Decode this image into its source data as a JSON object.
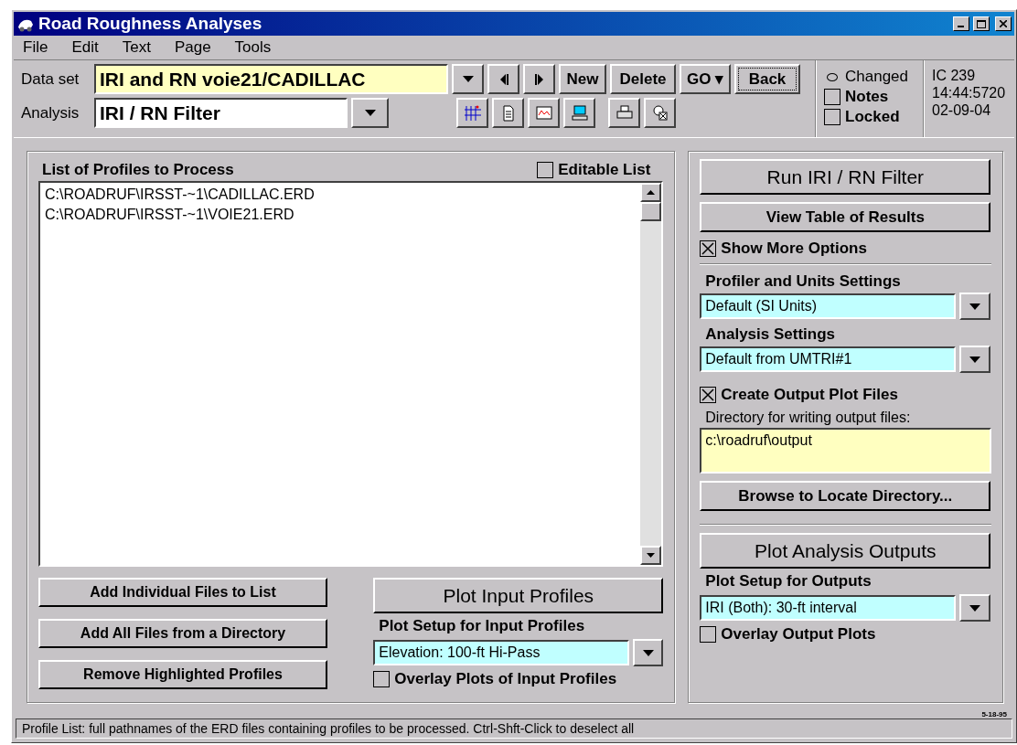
{
  "window": {
    "title": "Road Roughness Analyses"
  },
  "menu": [
    {
      "label": "File"
    },
    {
      "label": "Edit"
    },
    {
      "label": "Text"
    },
    {
      "label": "Page"
    },
    {
      "label": "Tools"
    }
  ],
  "toolbar": {
    "dataset": {
      "label": "Data set",
      "value": "IRI and RN voie21/CADILLAC"
    },
    "analysis": {
      "label": "Analysis",
      "value": "IRI / RN Filter"
    },
    "buttons": [
      {
        "label": "New",
        "focused": false
      },
      {
        "label": "Delete",
        "focused": false
      },
      {
        "label": "GO ▾",
        "focused": false
      },
      {
        "label": "Back",
        "focused": true
      }
    ],
    "changed": {
      "label": "Changed",
      "selected": false
    },
    "notes": {
      "label": "Notes",
      "checked": false
    },
    "locked": {
      "label": "Locked",
      "checked": false
    },
    "info": [
      "IC 239",
      "14:44:5720",
      "02-09-04"
    ]
  },
  "left": {
    "list_title": "List of Profiles to Process",
    "editable": {
      "label": "Editable List",
      "checked": false
    },
    "files": [
      {
        "text": "C:\\ROADRUF\\IRSST-~1\\CADILLAC.ERD",
        "selected": false
      },
      {
        "text": "C:\\ROADRUF\\IRSST-~1\\VOIE21.ERD",
        "selected": false
      }
    ],
    "buttons": [
      "Add Individual Files to List",
      "Add All Files from a Directory",
      "Remove Highlighted Profiles"
    ],
    "plot_button": "Plot Input Profiles",
    "plot_setup": {
      "label": "Plot Setup for Input Profiles",
      "value": "Elevation: 100-ft Hi-Pass"
    },
    "overlay": {
      "label": "Overlay Plots of Input Profiles",
      "checked": false
    }
  },
  "right": {
    "run_button": "Run IRI / RN Filter",
    "table_button": "View Table of Results",
    "more_options": {
      "label": "Show More Options",
      "checked": true
    },
    "profiler": {
      "label": "Profiler and Units Settings",
      "value": "Default (SI Units)"
    },
    "analysis_settings": {
      "label": "Analysis Settings",
      "value": "Default from UMTRI#1"
    },
    "create_plots": {
      "label": "Create Output Plot Files",
      "checked": true
    },
    "directory": {
      "label": "Directory for writing output files:",
      "value": "c:\\roadruf\\output"
    },
    "browse_button": "Browse to Locate Directory...",
    "plot_button": "Plot Analysis Outputs",
    "plot_setup": {
      "label": "Plot Setup for Outputs",
      "value": "IRI (Both): 30-ft interval"
    },
    "overlay": {
      "label": "Overlay Output Plots",
      "checked": false
    }
  },
  "version": "5-18-95",
  "status_bar": "Profile List: full pathnames of the ERD files containing profiles to be processed. Ctrl-Shft-Click to deselect all"
}
